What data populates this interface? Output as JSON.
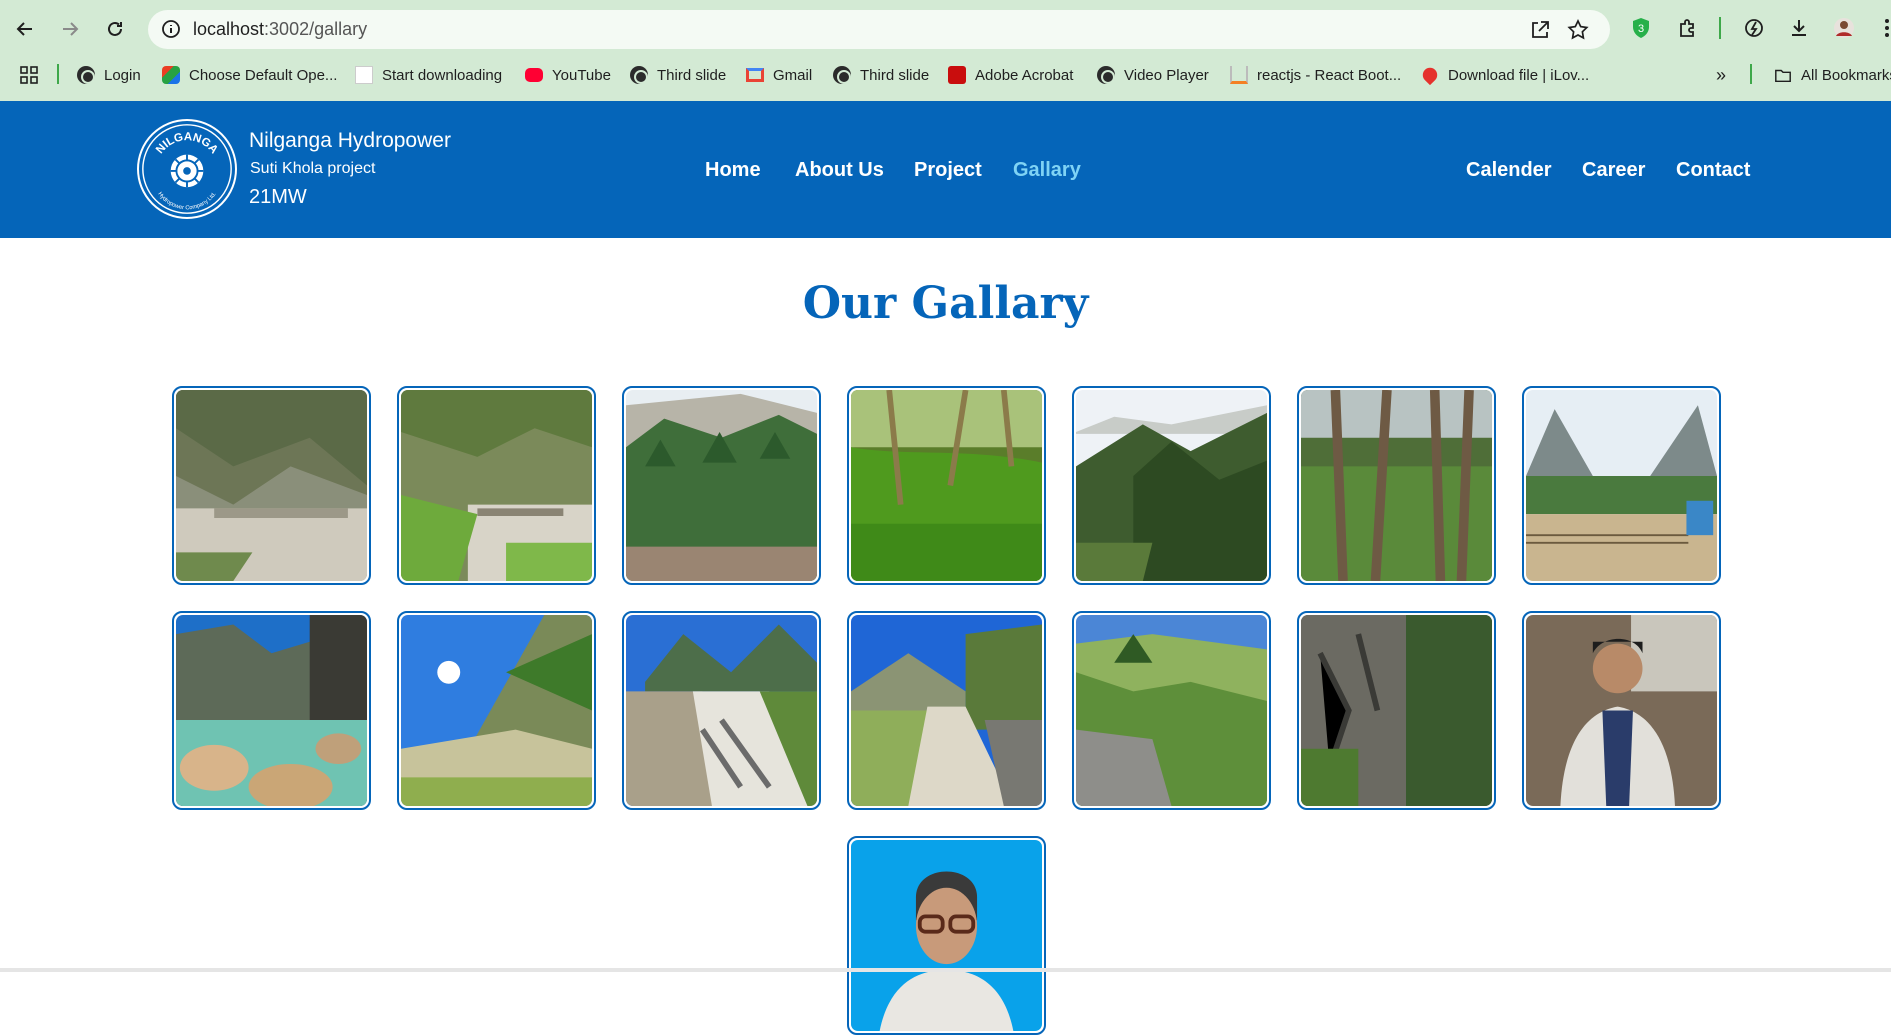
{
  "browser": {
    "url_host": "localhost",
    "url_path": ":3002/gallary",
    "bookmarks": [
      {
        "label": "Login",
        "icon": "globe-icon"
      },
      {
        "label": "Choose Default Ope...",
        "icon": "office-icon"
      },
      {
        "label": "Start downloading",
        "icon": "blank-page-icon"
      },
      {
        "label": "YouTube",
        "icon": "youtube-icon"
      },
      {
        "label": "Third slide",
        "icon": "globe-icon"
      },
      {
        "label": "Gmail",
        "icon": "gmail-icon"
      },
      {
        "label": "Third slide",
        "icon": "globe-icon"
      },
      {
        "label": "Adobe Acrobat",
        "icon": "acrobat-icon"
      },
      {
        "label": "Video Player",
        "icon": "globe-icon"
      },
      {
        "label": "reactjs - React Boot...",
        "icon": "stackoverflow-icon"
      },
      {
        "label": "Download file | iLov...",
        "icon": "ilovepdf-icon"
      }
    ],
    "all_bookmarks": "All Bookmarks",
    "extension_badge": "3"
  },
  "site": {
    "logo_text": "NILGANGA",
    "logo_subtext": "Hydropower Company Ltd.",
    "brand_title": "Nilganga Hydropower",
    "brand_subtitle": "Suti Khola project",
    "brand_capacity": "21MW",
    "nav_left": [
      "Home",
      "About Us",
      "Project",
      "Gallary"
    ],
    "nav_right": [
      "Calender",
      "Career",
      "Contact"
    ],
    "active_nav": "Gallary"
  },
  "main": {
    "heading": "Our Gallary",
    "images": [
      "river-valley-photo",
      "river-bridge-photo",
      "pine-forest-photo",
      "green-forest-floor-photo",
      "forested-mountain-photo",
      "tree-trunks-photo",
      "mountain-village-photo",
      "rocky-river-photo",
      "hillside-trail-photo",
      "stone-wall-path-photo",
      "rural-road-photo",
      "green-slope-trail-photo",
      "rock-cliff-photo",
      "man-in-blazer-portrait",
      "man-with-glasses-portrait"
    ]
  },
  "colors": {
    "brand_blue": "#0565b9",
    "active_link": "#7fd3f5",
    "chrome_green": "#d3ead4"
  }
}
